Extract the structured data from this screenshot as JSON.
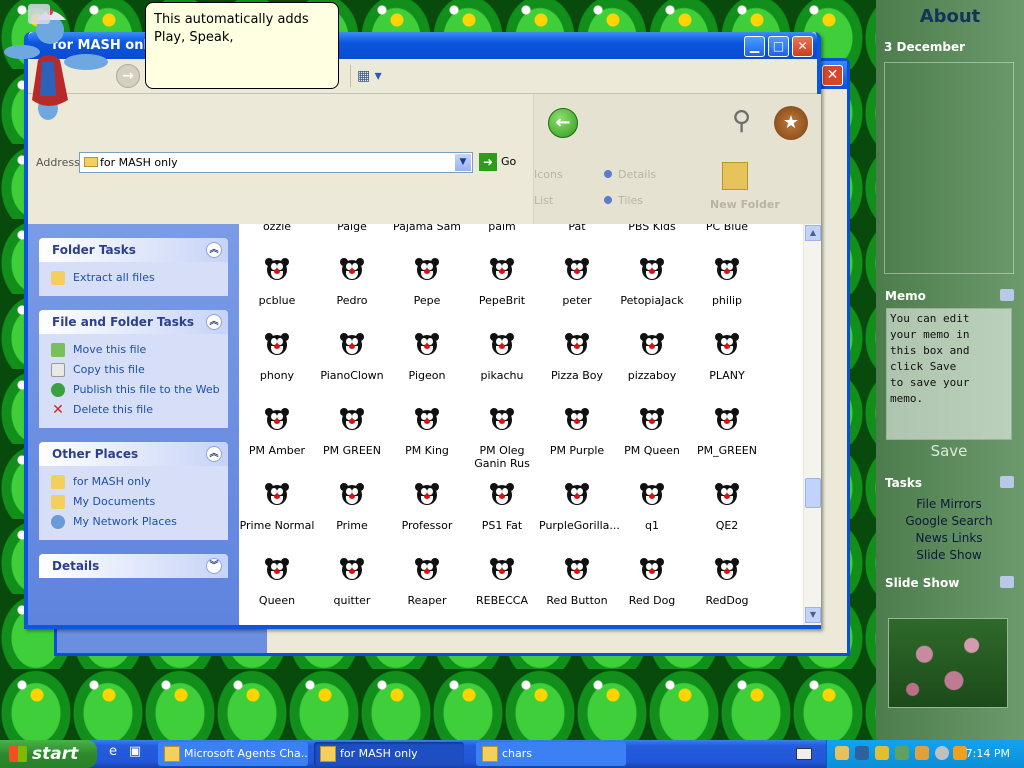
{
  "window": {
    "title": "for MASH only"
  },
  "balloon": {
    "text": "This automatically adds Play, Speak,"
  },
  "address": {
    "label": "Address",
    "value": "for MASH only",
    "go": "Go"
  },
  "right_panel_faint": {
    "item1": "Icons",
    "item2": "List",
    "item3": "Details",
    "item4": "Tiles",
    "new_folder": "New Folder"
  },
  "left_pane": {
    "folder_tasks": {
      "title": "Folder Tasks",
      "items": [
        "Extract all files"
      ]
    },
    "file_folder_tasks": {
      "title": "File and Folder Tasks",
      "items": [
        "Move this file",
        "Copy this file",
        "Publish this file to the Web",
        "Delete this file"
      ]
    },
    "other_places": {
      "title": "Other Places",
      "items": [
        "for MASH only",
        "My Documents",
        "My Network Places"
      ]
    },
    "details": {
      "title": "Details"
    }
  },
  "files": {
    "partial_top": [
      "ozzie",
      "Paige",
      "Pajama Sam",
      "palm",
      "Pat",
      "PBS Kids Logo",
      "PC Blue"
    ],
    "rows": [
      [
        "pcblue",
        "Pedro",
        "Pepe",
        "PepeBrit",
        "peter",
        "PetopiaJack",
        "philip"
      ],
      [
        "phony",
        "PianoClown",
        "Pigeon",
        "pikachu",
        "Pizza Boy",
        "pizzaboy",
        "PLANY"
      ],
      [
        "PM Amber",
        "PM GREEN",
        "PM King",
        "PM Oleg Ganin Rus",
        "PM Purple",
        "PM Queen",
        "PM_GREEN"
      ],
      [
        "Prime Normal",
        "Prime",
        "Professor",
        "PS1 Fat",
        "PurpleGorilla...",
        "q1",
        "QE2"
      ],
      [
        "Queen",
        "quitter",
        "Reaper",
        "REBECCA",
        "Red Button",
        "Red Dog",
        "RedDog"
      ]
    ]
  },
  "sidebar": {
    "title": "About",
    "calendar_date": "3 December",
    "memo_title": "Memo",
    "memo_text": "You can edit\nyour memo in\nthis box and\nclick Save\nto save your\nmemo.",
    "memo_save": "Save",
    "tasks_title": "Tasks",
    "tasks": [
      "File Mirrors",
      "Google Search",
      "News Links",
      "Slide Show"
    ],
    "slideshow_title": "Slide Show"
  },
  "taskbar": {
    "start": "start",
    "items": [
      "Microsoft Agents Cha...",
      "for MASH only",
      "chars"
    ],
    "clock": "7:14 PM"
  },
  "colors": {
    "accent": "#0c57dc",
    "taskpane": "#6f8fe3",
    "start_green": "#2f8a2f"
  }
}
